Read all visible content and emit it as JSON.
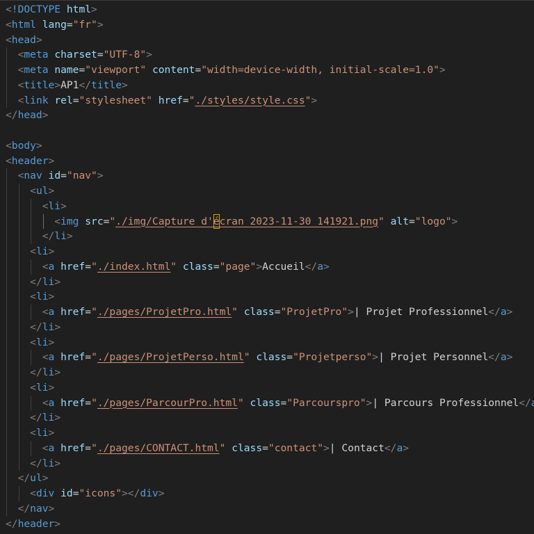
{
  "editor": {
    "language": "html",
    "colors": {
      "background": "#1f1f1f",
      "tag": "#569cd6",
      "punctuation": "#808080",
      "attribute": "#9cdcfe",
      "string": "#ce9178",
      "text": "#d4d4d4",
      "cursor_highlight": "#d7a600"
    },
    "lines": [
      {
        "indent": 0,
        "tokens": [
          [
            "punct",
            "<"
          ],
          [
            "tag",
            "!DOCTYPE"
          ],
          [
            "text",
            " "
          ],
          [
            "attr",
            "html"
          ],
          [
            "punct",
            ">"
          ]
        ]
      },
      {
        "indent": 0,
        "tokens": [
          [
            "punct",
            "<"
          ],
          [
            "tag",
            "html"
          ],
          [
            "text",
            " "
          ],
          [
            "attr",
            "lang"
          ],
          [
            "text",
            "="
          ],
          [
            "str",
            "\"fr\""
          ],
          [
            "punct",
            ">"
          ]
        ]
      },
      {
        "indent": 0,
        "tokens": [
          [
            "punct",
            "<"
          ],
          [
            "tag",
            "head"
          ],
          [
            "punct",
            ">"
          ]
        ]
      },
      {
        "indent": 1,
        "tokens": [
          [
            "punct",
            "<"
          ],
          [
            "tag",
            "meta"
          ],
          [
            "text",
            " "
          ],
          [
            "attr",
            "charset"
          ],
          [
            "text",
            "="
          ],
          [
            "str",
            "\"UTF-8\""
          ],
          [
            "punct",
            ">"
          ]
        ]
      },
      {
        "indent": 1,
        "tokens": [
          [
            "punct",
            "<"
          ],
          [
            "tag",
            "meta"
          ],
          [
            "text",
            " "
          ],
          [
            "attr",
            "name"
          ],
          [
            "text",
            "="
          ],
          [
            "str",
            "\"viewport\""
          ],
          [
            "text",
            " "
          ],
          [
            "attr",
            "content"
          ],
          [
            "text",
            "="
          ],
          [
            "str",
            "\"width=device-width, initial-scale=1.0\""
          ],
          [
            "punct",
            ">"
          ]
        ]
      },
      {
        "indent": 1,
        "tokens": [
          [
            "punct",
            "<"
          ],
          [
            "tag",
            "title"
          ],
          [
            "punct",
            ">"
          ],
          [
            "text",
            "AP1"
          ],
          [
            "punct",
            "</"
          ],
          [
            "tag",
            "title"
          ],
          [
            "punct",
            ">"
          ]
        ]
      },
      {
        "indent": 1,
        "tokens": [
          [
            "punct",
            "<"
          ],
          [
            "tag",
            "link"
          ],
          [
            "text",
            " "
          ],
          [
            "attr",
            "rel"
          ],
          [
            "text",
            "="
          ],
          [
            "str",
            "\"stylesheet\""
          ],
          [
            "text",
            " "
          ],
          [
            "attr",
            "href"
          ],
          [
            "text",
            "="
          ],
          [
            "str",
            "\""
          ],
          [
            "link",
            "./styles/style.css"
          ],
          [
            "str",
            "\""
          ],
          [
            "punct",
            ">"
          ]
        ]
      },
      {
        "indent": 0,
        "tokens": [
          [
            "punct",
            "</"
          ],
          [
            "tag",
            "head"
          ],
          [
            "punct",
            ">"
          ]
        ]
      },
      {
        "indent": 0,
        "tokens": []
      },
      {
        "indent": 0,
        "tokens": [
          [
            "punct",
            "<"
          ],
          [
            "tag",
            "body"
          ],
          [
            "punct",
            ">"
          ]
        ]
      },
      {
        "indent": 0,
        "tokens": [
          [
            "punct",
            "<"
          ],
          [
            "tag",
            "header"
          ],
          [
            "punct",
            ">"
          ]
        ]
      },
      {
        "indent": 1,
        "tokens": [
          [
            "punct",
            "<"
          ],
          [
            "tag",
            "nav"
          ],
          [
            "text",
            " "
          ],
          [
            "attr",
            "id"
          ],
          [
            "text",
            "="
          ],
          [
            "str",
            "\"nav\""
          ],
          [
            "punct",
            ">"
          ]
        ]
      },
      {
        "indent": 2,
        "tokens": [
          [
            "punct",
            "<"
          ],
          [
            "tag",
            "ul"
          ],
          [
            "punct",
            ">"
          ]
        ]
      },
      {
        "indent": 3,
        "tokens": [
          [
            "punct",
            "<"
          ],
          [
            "tag",
            "li"
          ],
          [
            "punct",
            ">"
          ]
        ]
      },
      {
        "indent": 4,
        "cursor": true,
        "tokens": [
          [
            "punct",
            "<"
          ],
          [
            "tag",
            "img"
          ],
          [
            "text",
            " "
          ],
          [
            "attr",
            "src"
          ],
          [
            "text",
            "="
          ],
          [
            "str",
            "\""
          ],
          [
            "link",
            "./img/Capture d'"
          ],
          [
            "cursor",
            "é"
          ],
          [
            "link",
            "cran 2023-11-30 141921.png"
          ],
          [
            "str",
            "\""
          ],
          [
            "text",
            " "
          ],
          [
            "attr",
            "alt"
          ],
          [
            "text",
            "="
          ],
          [
            "str",
            "\"logo\""
          ],
          [
            "punct",
            ">"
          ]
        ]
      },
      {
        "indent": 3,
        "tokens": [
          [
            "punct",
            "</"
          ],
          [
            "tag",
            "li"
          ],
          [
            "punct",
            ">"
          ]
        ]
      },
      {
        "indent": 2,
        "tokens": [
          [
            "punct",
            "<"
          ],
          [
            "tag",
            "li"
          ],
          [
            "punct",
            ">"
          ]
        ]
      },
      {
        "indent": 3,
        "tokens": [
          [
            "punct",
            "<"
          ],
          [
            "tag",
            "a"
          ],
          [
            "text",
            " "
          ],
          [
            "attr",
            "href"
          ],
          [
            "text",
            "="
          ],
          [
            "str",
            "\""
          ],
          [
            "link",
            "./index.html"
          ],
          [
            "str",
            "\""
          ],
          [
            "text",
            " "
          ],
          [
            "attr",
            "class"
          ],
          [
            "text",
            "="
          ],
          [
            "str",
            "\"page\""
          ],
          [
            "punct",
            ">"
          ],
          [
            "text",
            "Accueil"
          ],
          [
            "punct",
            "</"
          ],
          [
            "tag",
            "a"
          ],
          [
            "punct",
            ">"
          ]
        ]
      },
      {
        "indent": 2,
        "tokens": [
          [
            "punct",
            "</"
          ],
          [
            "tag",
            "li"
          ],
          [
            "punct",
            ">"
          ]
        ]
      },
      {
        "indent": 2,
        "tokens": [
          [
            "punct",
            "<"
          ],
          [
            "tag",
            "li"
          ],
          [
            "punct",
            ">"
          ]
        ]
      },
      {
        "indent": 3,
        "tokens": [
          [
            "punct",
            "<"
          ],
          [
            "tag",
            "a"
          ],
          [
            "text",
            " "
          ],
          [
            "attr",
            "href"
          ],
          [
            "text",
            "="
          ],
          [
            "str",
            "\""
          ],
          [
            "link",
            "./pages/ProjetPro.html"
          ],
          [
            "str",
            "\""
          ],
          [
            "text",
            " "
          ],
          [
            "attr",
            "class"
          ],
          [
            "text",
            "="
          ],
          [
            "str",
            "\"ProjetPro\""
          ],
          [
            "punct",
            ">"
          ],
          [
            "text",
            "| Projet Professionnel"
          ],
          [
            "punct",
            "</"
          ],
          [
            "tag",
            "a"
          ],
          [
            "punct",
            ">"
          ]
        ]
      },
      {
        "indent": 2,
        "tokens": [
          [
            "punct",
            "</"
          ],
          [
            "tag",
            "li"
          ],
          [
            "punct",
            ">"
          ]
        ]
      },
      {
        "indent": 2,
        "tokens": [
          [
            "punct",
            "<"
          ],
          [
            "tag",
            "li"
          ],
          [
            "punct",
            ">"
          ]
        ]
      },
      {
        "indent": 3,
        "tokens": [
          [
            "punct",
            "<"
          ],
          [
            "tag",
            "a"
          ],
          [
            "text",
            " "
          ],
          [
            "attr",
            "href"
          ],
          [
            "text",
            "="
          ],
          [
            "str",
            "\""
          ],
          [
            "link",
            "./pages/ProjetPerso.html"
          ],
          [
            "str",
            "\""
          ],
          [
            "text",
            " "
          ],
          [
            "attr",
            "class"
          ],
          [
            "text",
            "="
          ],
          [
            "str",
            "\"Projetperso\""
          ],
          [
            "punct",
            ">"
          ],
          [
            "text",
            "| Projet Personnel"
          ],
          [
            "punct",
            "</"
          ],
          [
            "tag",
            "a"
          ],
          [
            "punct",
            ">"
          ]
        ]
      },
      {
        "indent": 2,
        "tokens": [
          [
            "punct",
            "</"
          ],
          [
            "tag",
            "li"
          ],
          [
            "punct",
            ">"
          ]
        ]
      },
      {
        "indent": 2,
        "tokens": [
          [
            "punct",
            "<"
          ],
          [
            "tag",
            "li"
          ],
          [
            "punct",
            ">"
          ]
        ]
      },
      {
        "indent": 3,
        "tokens": [
          [
            "punct",
            "<"
          ],
          [
            "tag",
            "a"
          ],
          [
            "text",
            " "
          ],
          [
            "attr",
            "href"
          ],
          [
            "text",
            "="
          ],
          [
            "str",
            "\""
          ],
          [
            "link",
            "./pages/ParcourPro.html"
          ],
          [
            "str",
            "\""
          ],
          [
            "text",
            " "
          ],
          [
            "attr",
            "class"
          ],
          [
            "text",
            "="
          ],
          [
            "str",
            "\"Parcourspro\""
          ],
          [
            "punct",
            ">"
          ],
          [
            "text",
            "| Parcours Professionnel"
          ],
          [
            "punct",
            "</"
          ],
          [
            "tag",
            "a"
          ],
          [
            "punct",
            ">"
          ]
        ]
      },
      {
        "indent": 2,
        "tokens": [
          [
            "punct",
            "</"
          ],
          [
            "tag",
            "li"
          ],
          [
            "punct",
            ">"
          ]
        ]
      },
      {
        "indent": 2,
        "tokens": [
          [
            "punct",
            "<"
          ],
          [
            "tag",
            "li"
          ],
          [
            "punct",
            ">"
          ]
        ]
      },
      {
        "indent": 3,
        "tokens": [
          [
            "punct",
            "<"
          ],
          [
            "tag",
            "a"
          ],
          [
            "text",
            " "
          ],
          [
            "attr",
            "href"
          ],
          [
            "text",
            "="
          ],
          [
            "str",
            "\""
          ],
          [
            "link",
            "./pages/CONTACT.html"
          ],
          [
            "str",
            "\""
          ],
          [
            "text",
            " "
          ],
          [
            "attr",
            "class"
          ],
          [
            "text",
            "="
          ],
          [
            "str",
            "\"contact\""
          ],
          [
            "punct",
            ">"
          ],
          [
            "text",
            "| Contact"
          ],
          [
            "punct",
            "</"
          ],
          [
            "tag",
            "a"
          ],
          [
            "punct",
            ">"
          ]
        ]
      },
      {
        "indent": 2,
        "tokens": [
          [
            "punct",
            "</"
          ],
          [
            "tag",
            "li"
          ],
          [
            "punct",
            ">"
          ]
        ]
      },
      {
        "indent": 1,
        "tokens": [
          [
            "punct",
            "</"
          ],
          [
            "tag",
            "ul"
          ],
          [
            "punct",
            ">"
          ]
        ]
      },
      {
        "indent": 2,
        "tokens": [
          [
            "punct",
            "<"
          ],
          [
            "tag",
            "div"
          ],
          [
            "text",
            " "
          ],
          [
            "attr",
            "id"
          ],
          [
            "text",
            "="
          ],
          [
            "str",
            "\"icons\""
          ],
          [
            "punct",
            "></"
          ],
          [
            "tag",
            "div"
          ],
          [
            "punct",
            ">"
          ]
        ]
      },
      {
        "indent": 1,
        "tokens": [
          [
            "punct",
            "</"
          ],
          [
            "tag",
            "nav"
          ],
          [
            "punct",
            ">"
          ]
        ]
      },
      {
        "indent": 0,
        "tokens": [
          [
            "punct",
            "</"
          ],
          [
            "tag",
            "header"
          ],
          [
            "punct",
            ">"
          ]
        ]
      }
    ]
  }
}
